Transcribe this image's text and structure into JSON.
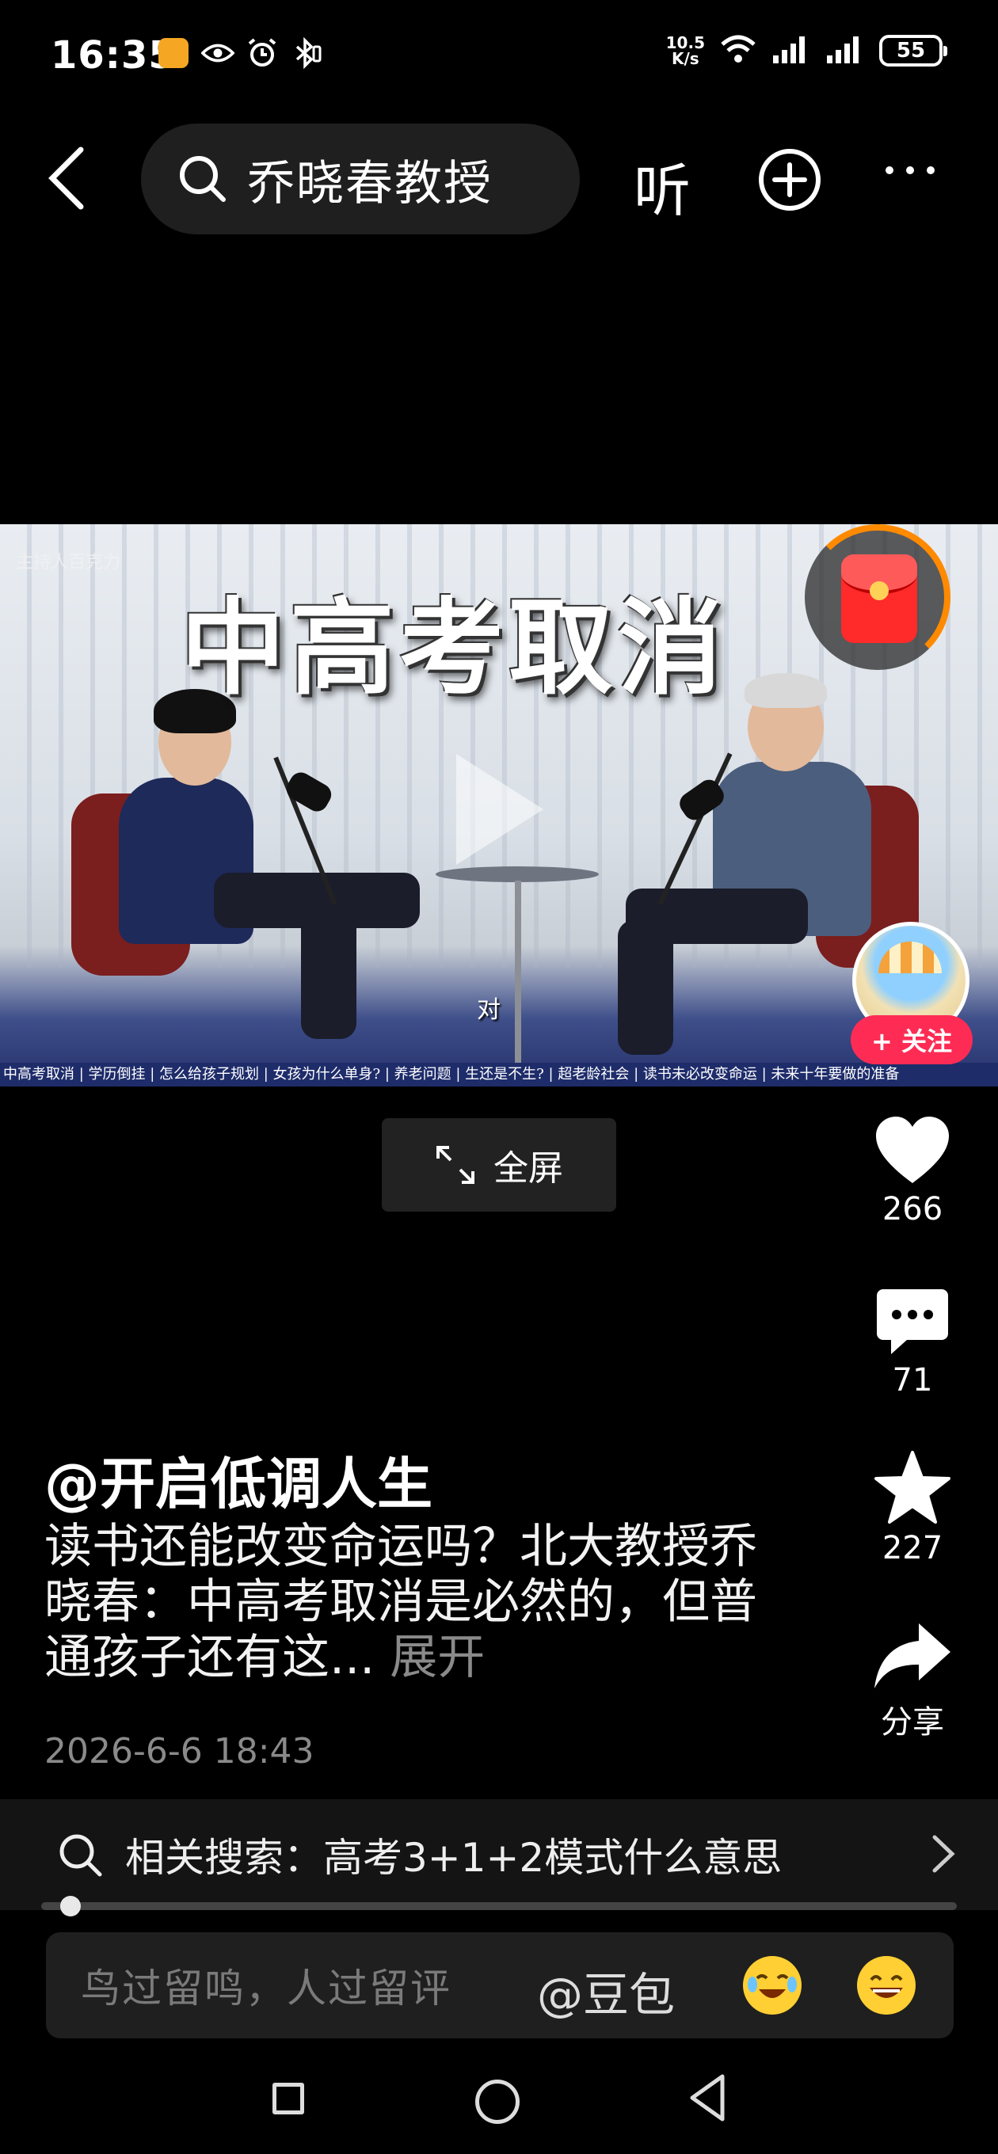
{
  "status_bar": {
    "time": "16:35",
    "net_speed_value": "10.5",
    "net_speed_unit": "K/s",
    "battery": "55"
  },
  "top_bar": {
    "search_query": "乔晓春教授",
    "listen_label": "听"
  },
  "video": {
    "headline": "中高考取消",
    "host_label": "主持人百克力",
    "subtitle": "对",
    "ticker": "中高考取消 | 学历倒挂 | 怎么给孩子规划 | 女孩为什么单身? | 养老问题 | 生还是不生? | 超老龄社会 | 读书未必改变命运 | 未来十年要做的准备",
    "follow_label": "+ 关注"
  },
  "fullscreen_label": "全屏",
  "actions": {
    "likes": "266",
    "comments": "71",
    "favorites": "227",
    "share_label": "分享"
  },
  "caption": {
    "author": "@开启低调人生",
    "description": "读书还能改变命运吗？北大教授乔晓春：中高考取消是必然的，但普通孩子还有这...",
    "expand_label": "展开",
    "date": "2026-6-6 18:43"
  },
  "related_search": {
    "text": "相关搜索：高考3+1+2模式什么意思"
  },
  "comment_bar": {
    "placeholder": "鸟过留鸣，人过留评",
    "mention": "@豆包"
  },
  "colors": {
    "accent_red": "#fe2c55",
    "ring_orange": "#ff8a00",
    "ticker_blue": "#1e2c6a"
  }
}
